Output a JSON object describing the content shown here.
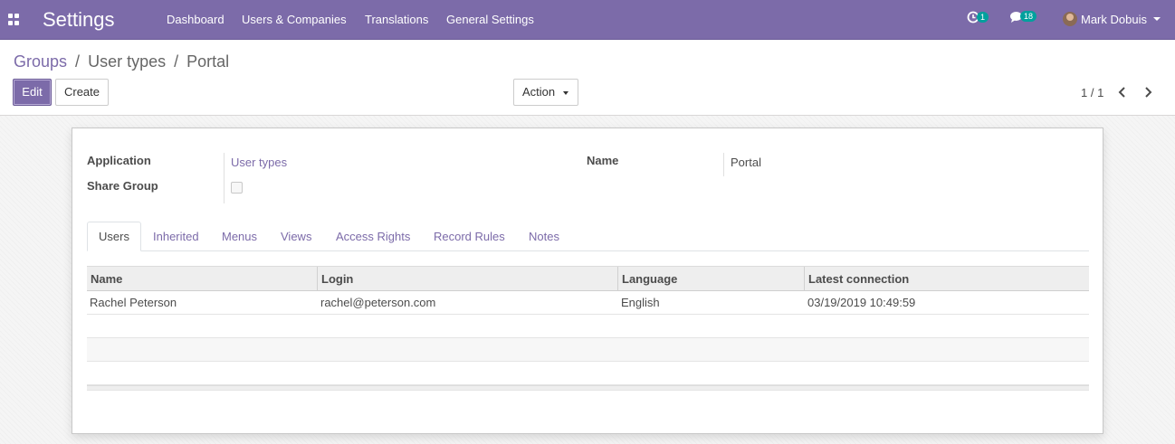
{
  "navbar": {
    "app_title": "Settings",
    "menu": {
      "dashboard": "Dashboard",
      "users_companies": "Users & Companies",
      "translations": "Translations",
      "general_settings": "General Settings"
    },
    "activity_count": "1",
    "messages_count": "18",
    "user_name": "Mark Dobuis",
    "accent_color": "#7c6ba9",
    "badge_color": "#00a09d"
  },
  "breadcrumb": {
    "groups": "Groups",
    "separator": "/",
    "user_types": "User types",
    "current": "Portal"
  },
  "control": {
    "edit_label": "Edit",
    "create_label": "Create",
    "action_label": "Action",
    "pager_value": "1 / 1"
  },
  "form": {
    "application_label": "Application",
    "application_value": "User types",
    "share_group_label": "Share Group",
    "share_group_checked": false,
    "name_label": "Name",
    "name_value": "Portal"
  },
  "tabs": {
    "users": "Users",
    "inherited": "Inherited",
    "menus": "Menus",
    "views": "Views",
    "access_rights": "Access Rights",
    "record_rules": "Record Rules",
    "notes": "Notes",
    "active": "Users"
  },
  "users_table": {
    "headers": {
      "name": "Name",
      "login": "Login",
      "language": "Language",
      "latest_connection": "Latest connection"
    },
    "rows": [
      {
        "name": "Rachel Peterson",
        "login": "rachel@peterson.com",
        "language": "English",
        "latest_connection": "03/19/2019 10:49:59"
      }
    ]
  }
}
